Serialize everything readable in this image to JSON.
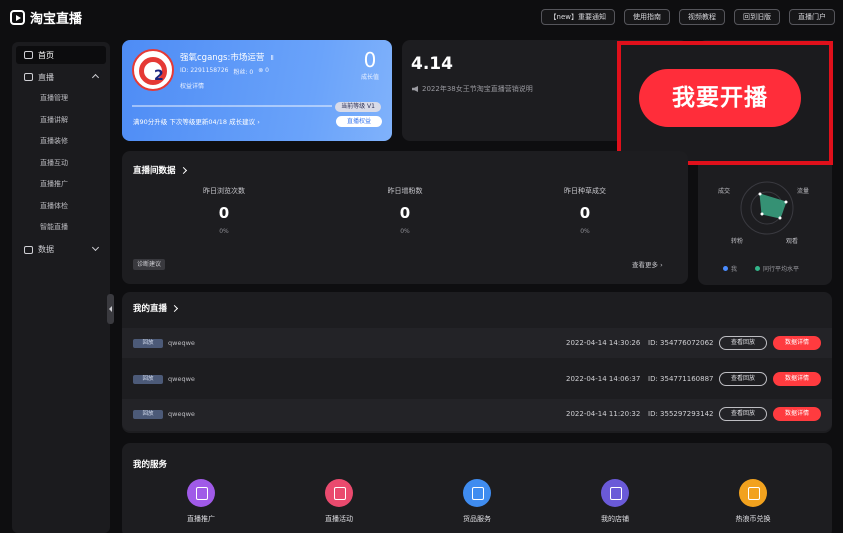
{
  "app": {
    "title": "淘宝直播"
  },
  "topnav": [
    "【new】重要通知",
    "使用指南",
    "视频教程",
    "回到旧版",
    "直播门户"
  ],
  "sidebar": {
    "home": "首页",
    "live": "直播",
    "live_items": [
      "直播管理",
      "直播讲解",
      "直播装修",
      "直播互动",
      "直播推广",
      "直播体检",
      "智能直播"
    ],
    "data": "数据"
  },
  "profile": {
    "name": "强氧cgangs:市场运营",
    "level_suffix": "Ⅱ",
    "meta": [
      "ID: 2291158726",
      "粉丝: 0",
      "⊗ 0"
    ],
    "status": "权益详情",
    "score": "0",
    "score_label": "成长值",
    "level_badge": "当前等级 V1",
    "tip": "满90分升级 下次等级更新04/18 成长建议 ›",
    "tip_button": "直播权益",
    "progress": 0
  },
  "notice": {
    "version": "4.14",
    "text": "2022年38女王节淘宝直播营销说明"
  },
  "start_button": "我要开播",
  "radar": {
    "labels": [
      "成交",
      "流量",
      "转粉",
      "观看"
    ],
    "legend": [
      "我",
      "同行平均水平"
    ],
    "colors": {
      "me": "#4a8cff",
      "peer": "#33b58a"
    }
  },
  "room_data": {
    "title": "直播间数据",
    "stats": [
      {
        "label": "昨日浏览次数",
        "value": "0",
        "pct": "0%"
      },
      {
        "label": "昨日增粉数",
        "value": "0",
        "pct": "0%"
      },
      {
        "label": "昨日种草成交",
        "value": "0",
        "pct": "0%"
      }
    ],
    "diag_button": "诊断建议",
    "see_more": "查看更多 ›"
  },
  "my_lives": {
    "title": "我的直播",
    "rows": [
      {
        "tag": "回放",
        "name": "qweqwe",
        "time": "2022-04-14 14:30:26",
        "id": "ID: 354776072062"
      },
      {
        "tag": "回放",
        "name": "qweqwe",
        "time": "2022-04-14 14:06:37",
        "id": "ID: 354771160887"
      },
      {
        "tag": "回放",
        "name": "qweqwe",
        "time": "2022-04-14 11:20:32",
        "id": "ID: 355297293142"
      }
    ],
    "replay_label": "查看回放",
    "detail_label": "数据详情"
  },
  "services": {
    "title": "我的服务",
    "items": [
      {
        "label": "直播推广",
        "color": "#a05ae8"
      },
      {
        "label": "直播活动",
        "color": "#ea4a6e"
      },
      {
        "label": "货品服务",
        "color": "#3f8cf0"
      },
      {
        "label": "我的店铺",
        "color": "#6a5ad8"
      },
      {
        "label": "热浪币兑换",
        "color": "#f2a21e"
      }
    ]
  }
}
